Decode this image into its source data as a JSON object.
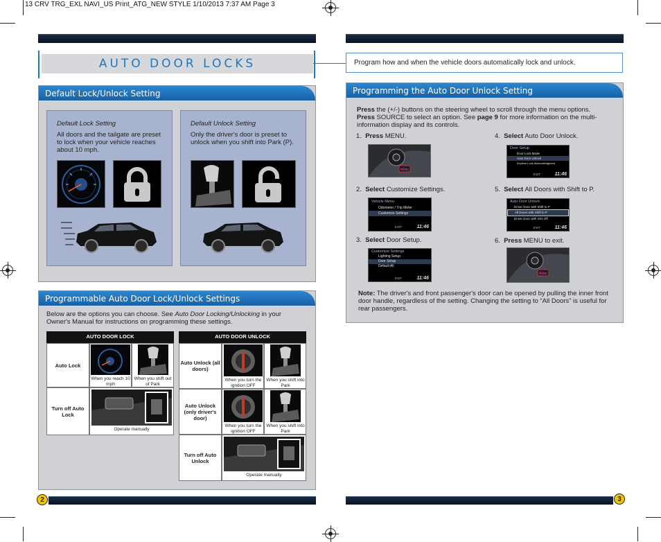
{
  "print_header": "13 CRV TRG_EXL NAVI_US Print_ATG_NEW STYLE  1/10/2013  7:37 AM  Page 3",
  "left": {
    "title": "AUTO DOOR LOCKS",
    "default_section": {
      "heading": "Default Lock/Unlock Setting",
      "lock_card": {
        "title": "Default Lock Setting",
        "text": "All doors and the tailgate are preset to lock when your vehicle reaches about 10 mph."
      },
      "unlock_card": {
        "title": "Default Unlock Setting",
        "text": "Only the driver's door is preset to unlock when you shift into Park (P)."
      }
    },
    "programmable_section": {
      "heading": "Programmable Auto Door Lock/Unlock Settings",
      "intro_pre": "Below are the options you can choose. See ",
      "intro_italic": "Auto Door Locking/Unlocking",
      "intro_post": " in your Owner's Manual for instructions on programming these settings.",
      "lock_table": {
        "header": "AUTO DOOR LOCK",
        "rows": [
          {
            "label": "Auto Lock",
            "captions": [
              "When you reach 10 mph",
              "When you shift out of Park"
            ]
          },
          {
            "label": "Turn off Auto Lock",
            "captions": [
              "Operate manually"
            ]
          }
        ]
      },
      "unlock_table": {
        "header": "AUTO DOOR UNLOCK",
        "rows": [
          {
            "label": "Auto Unlock (all doors)",
            "captions": [
              "When you turn the ignition OFF",
              "When you shift into Park"
            ]
          },
          {
            "label": "Auto Unlock (only driver's door)",
            "captions": [
              "When you turn the ignition OFF",
              "When you shift into Park"
            ]
          },
          {
            "label": "Turn off Auto Unlock",
            "captions": [
              "Operate manually"
            ]
          }
        ]
      }
    },
    "page_number": "2"
  },
  "right": {
    "intro": "Program how and when the vehicle doors automatically lock and unlock.",
    "section_heading": "Programming the Auto Door Unlock Setting",
    "instructions": {
      "press1": "Press",
      "text1": " the (+/-) buttons on the steering wheel to scroll through the menu options.",
      "press2": "Press",
      "text2": " SOURCE to select an option. See ",
      "page_ref": "page 9",
      "text3": " for more information on the multi-information display and its controls."
    },
    "steps": [
      {
        "num": "1.",
        "verb": "Press",
        "rest": " MENU."
      },
      {
        "num": "2.",
        "verb": "Select",
        "rest": " Customize Settings."
      },
      {
        "num": "3.",
        "verb": "Select",
        "rest": " Door Setup."
      },
      {
        "num": "4.",
        "verb": "Select",
        "rest": " Auto Door Unlock."
      },
      {
        "num": "5.",
        "verb": "Select",
        "rest": " All Doors with Shift to P."
      },
      {
        "num": "6.",
        "verb": "Press",
        "rest": " MENU to exit."
      }
    ],
    "screens": {
      "s2": {
        "title": "Vehicle Menu",
        "items": [
          "Odometer / Trip Meter",
          "Customize Settings"
        ],
        "exit": "EXIT",
        "time": "11:46"
      },
      "s3": {
        "title": "Customize Settings",
        "items": [
          "Lighting Setup",
          "Door Setup",
          "Default All"
        ],
        "exit": "EXIT",
        "time": "11:46"
      },
      "s4": {
        "title": "Door Setup",
        "items": [
          "Door Lock Mode",
          "Auto Door Unlock",
          "Keyless Lock Acknowledgment"
        ],
        "exit": "EXIT",
        "time": "11:46"
      },
      "s5": {
        "title": "Auto Door Unlock",
        "items": [
          "Driver Door with Shift to P",
          "All Doors with Shift to P",
          "Driver Door with IGN Off"
        ],
        "exit": "EXIT",
        "time": "11:46"
      }
    },
    "menu_button_label": "MENU",
    "note_label": "Note:",
    "note_text": " The driver's and front passenger's door can be opened by pulling the inner front door handle, regardless of the setting. Changing the setting to “All Doors” is useful for rear passengers.",
    "page_number": "3"
  },
  "colors": {
    "accent": "#1f77bd",
    "panel": "#cfd1d5",
    "card": "#a8b4cf",
    "page_badge": "#f0c600"
  }
}
